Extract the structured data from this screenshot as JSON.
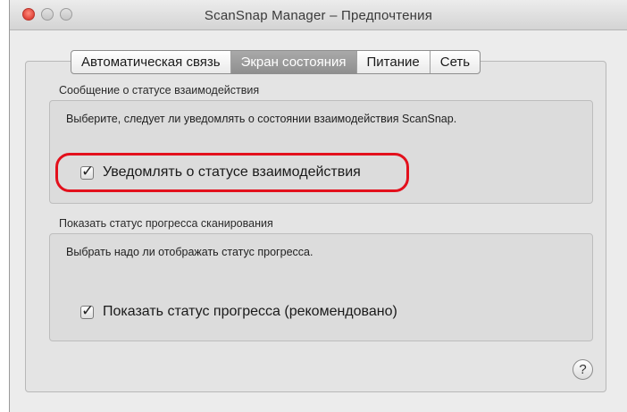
{
  "window": {
    "title": "ScanSnap Manager – Предпочтения"
  },
  "tabs": [
    {
      "label": "Автоматическая связь",
      "active": false
    },
    {
      "label": "Экран состояния",
      "active": true
    },
    {
      "label": "Питание",
      "active": false
    },
    {
      "label": "Сеть",
      "active": false
    }
  ],
  "section1": {
    "label": "Сообщение о статусе взаимодействия",
    "description": "Выберите, следует ли уведомлять о состоянии взаимодействия ScanSnap.",
    "checkbox": {
      "label": "Уведомлять о статусе взаимодействия",
      "checked": true
    }
  },
  "section2": {
    "label": "Показать статус прогресса сканирования",
    "description": "Выбрать надо ли отображать статус прогресса.",
    "checkbox": {
      "label": "Показать статус прогресса (рекомендовано)",
      "checked": true
    }
  },
  "help": {
    "label": "?"
  },
  "colors": {
    "highlight": "#e3101c",
    "active_tab": "#9c9c9c"
  },
  "icons": {
    "close": "close-icon",
    "minimize": "minimize-icon",
    "zoom": "zoom-icon",
    "help": "help-icon",
    "check": "checkmark-icon"
  }
}
